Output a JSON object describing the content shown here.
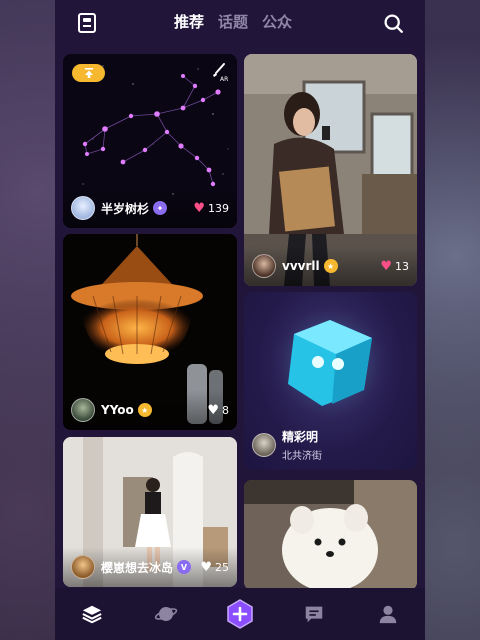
{
  "header": {
    "tabs": [
      {
        "label": "推荐",
        "active": true
      },
      {
        "label": "话题",
        "active": false
      },
      {
        "label": "公众",
        "active": false
      }
    ]
  },
  "feed": {
    "cards": [
      {
        "id": "card1",
        "username": "半岁树杉",
        "likes": "139",
        "badge_color": "#8a6cf0",
        "ar_label": "AR"
      },
      {
        "id": "card2",
        "username": "vvvrll",
        "likes": "13",
        "badge_color": "#f5b82e"
      },
      {
        "id": "card3",
        "username": "YYoo",
        "likes": "8",
        "badge_color": "#f5b82e"
      },
      {
        "id": "card4",
        "username": "精彩明",
        "location": "北共济街"
      },
      {
        "id": "card5",
        "username": "樱崽想去冰岛",
        "likes": "25",
        "badge_color": "#8a6cf0",
        "badge_text": "V"
      },
      {
        "id": "card6"
      }
    ]
  },
  "bottom_nav": {
    "items": [
      "layers-icon",
      "planet-icon",
      "add-post-icon",
      "message-icon",
      "profile-icon"
    ],
    "accent": "#8a4dff"
  },
  "colors": {
    "background": "#21163a",
    "like_heart": "#ff4f88",
    "gold_badge": "#f5b82e"
  }
}
